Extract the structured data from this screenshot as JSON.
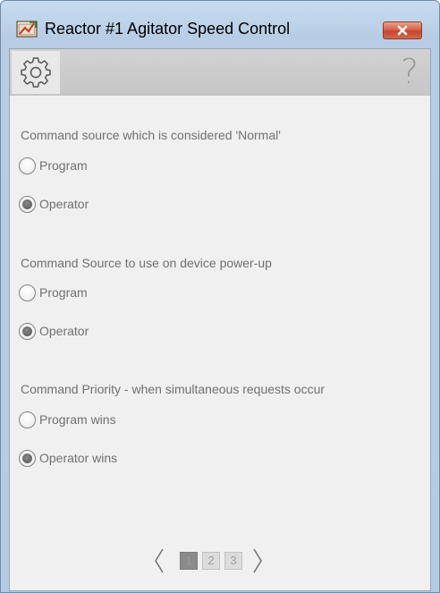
{
  "window": {
    "title": "Reactor #1 Agitator Speed Control",
    "app_icon": "faceplate-app-icon",
    "close_icon": "close-icon"
  },
  "toolbar": {
    "settings_icon": "gear-icon",
    "help_label": "?"
  },
  "sections": [
    {
      "label": "Command source which is considered 'Normal'",
      "options": [
        {
          "label": "Program",
          "checked": false
        },
        {
          "label": "Operator",
          "checked": true
        }
      ]
    },
    {
      "label": "Command Source to use on device power-up",
      "options": [
        {
          "label": "Program",
          "checked": false
        },
        {
          "label": "Operator",
          "checked": true
        }
      ]
    },
    {
      "label": "Command Priority - when simultaneous requests occur",
      "options": [
        {
          "label": "Program wins",
          "checked": false
        },
        {
          "label": "Operator wins",
          "checked": true
        }
      ]
    }
  ],
  "pager": {
    "prev_icon": "chevron-left-icon",
    "next_icon": "chevron-right-icon",
    "pages": [
      "1",
      "2",
      "3"
    ],
    "current_page": "1"
  },
  "colors": {
    "window_frame": "#b7cde5",
    "close_button": "#c6452c",
    "panel_background": "#f0f0f0",
    "text": "#707070"
  }
}
